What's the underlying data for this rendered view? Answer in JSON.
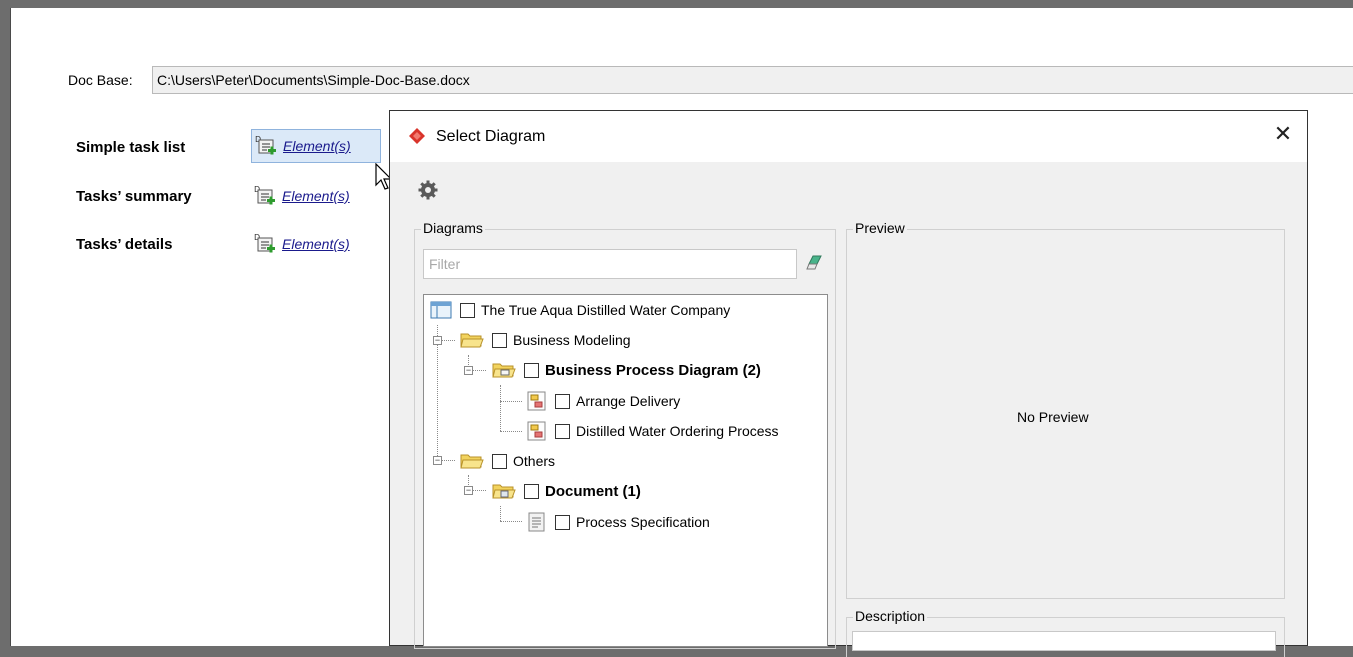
{
  "doc_base": {
    "label": "Doc Base:",
    "value": "C:\\Users\\Peter\\Documents\\Simple-Doc-Base.docx"
  },
  "rows": [
    {
      "label": "Simple task list",
      "link": "Element(s)"
    },
    {
      "label": "Tasks’ summary",
      "link": "Element(s)"
    },
    {
      "label": "Tasks’ details",
      "link": "Element(s)"
    }
  ],
  "dialog": {
    "title": "Select Diagram",
    "close_glyph": "✕",
    "diagrams_group": "Diagrams",
    "filter_placeholder": "Filter",
    "preview_group": "Preview",
    "preview_text": "No Preview",
    "description_group": "Description",
    "tree": [
      {
        "label": "The True Aqua Distilled Water Company"
      },
      {
        "label": "Business Modeling"
      },
      {
        "label": "Business Process Diagram (2)"
      },
      {
        "label": "Arrange Delivery"
      },
      {
        "label": "Distilled Water Ordering Process"
      },
      {
        "label": "Others"
      },
      {
        "label": "Document (1)"
      },
      {
        "label": "Process Specification"
      }
    ]
  },
  "colors": {
    "link": "#1a1a8c",
    "folder": "#f2d35e",
    "title_icon": "#d9342b"
  }
}
